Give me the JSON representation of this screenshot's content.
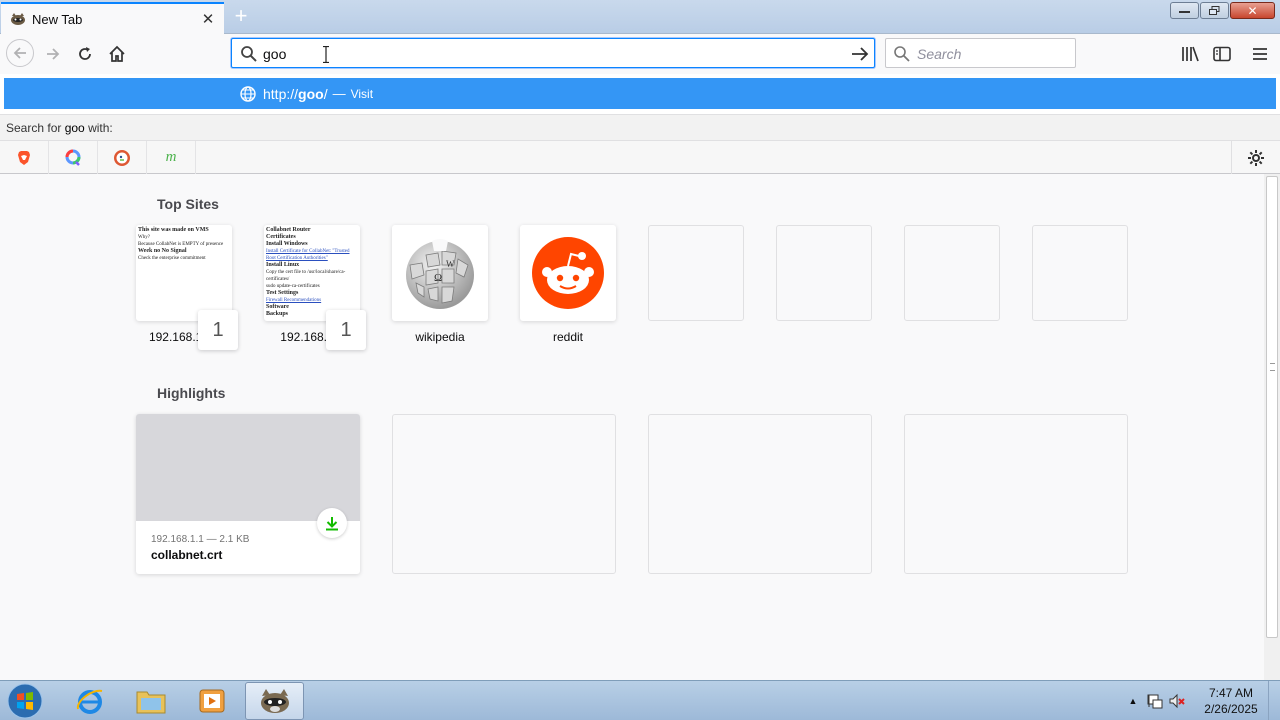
{
  "tab": {
    "title": "New Tab",
    "close_icon": "close-icon"
  },
  "urlbar": {
    "value": "goo"
  },
  "searchbar": {
    "placeholder": "Search"
  },
  "popup": {
    "url_prefix": "http://",
    "url_bold": "goo",
    "url_suffix": "/",
    "separator": "—",
    "action": "Visit",
    "search_with_prefix": "Search for ",
    "search_with_term": "goo",
    "search_with_suffix": " with:",
    "engines": [
      "brave-icon",
      "qwant-icon",
      "duckduckgo-icon",
      "yandex-m-icon"
    ]
  },
  "top_sites": {
    "title": "Top Sites",
    "items": [
      {
        "label": "192.168.1.13",
        "badge": "1",
        "thumb_lines": [
          "This site was made on VMS",
          "Why?",
          "Because CollabNet is EMPTY of presence",
          "Week no No Signal",
          "Check the enterprise commitment"
        ]
      },
      {
        "label": "192.168.1.1",
        "badge": "1",
        "thumb_lines": [
          "Collabnet Router",
          "Certificates",
          "Install Windows",
          "Install Certificate for CollabNet: \"Trusted Root Certification Authorities\"",
          "Install Linux",
          "Copy the cert file to /usr/local/share/ca-certificates/",
          "sudo update-ca-certificates",
          "Test Settings",
          "Firewall Recommendations",
          "Software",
          "Backups"
        ]
      },
      {
        "label": "wikipedia"
      },
      {
        "label": "reddit"
      }
    ]
  },
  "highlights": {
    "title": "Highlights",
    "item": {
      "meta": "192.168.1.1 — 2.1 KB",
      "title": "collabnet.crt"
    }
  },
  "taskbar": {
    "time": "7:47 AM",
    "date": "2/26/2025"
  },
  "colors": {
    "accent": "#0a84ff",
    "popup_highlight": "#3496f5",
    "reddit": "#ff4500",
    "download": "#12bc00"
  }
}
